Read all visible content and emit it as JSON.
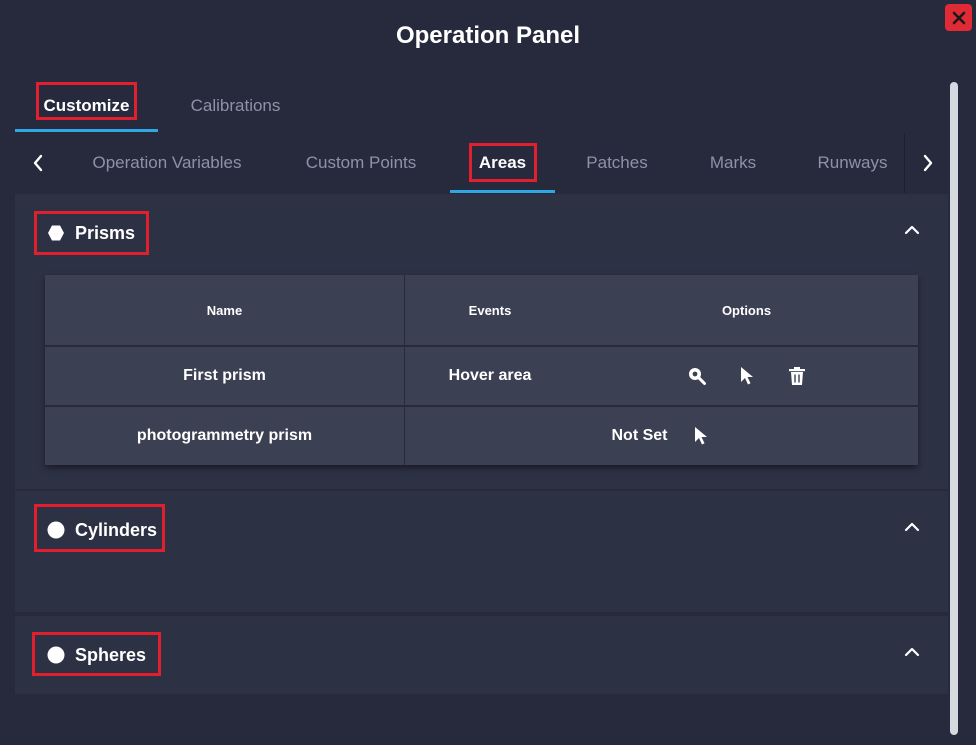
{
  "panel": {
    "title": "Operation Panel"
  },
  "main_tabs": [
    {
      "label": "Customize",
      "active": true
    },
    {
      "label": "Calibrations",
      "active": false
    }
  ],
  "sub_tabs": [
    {
      "label": "Operation Variables",
      "active": false
    },
    {
      "label": "Custom Points",
      "active": false
    },
    {
      "label": "Areas",
      "active": true
    },
    {
      "label": "Patches",
      "active": false
    },
    {
      "label": "Marks",
      "active": false
    },
    {
      "label": "Runways",
      "active": false
    }
  ],
  "sections": {
    "prisms": {
      "title": "Prisms",
      "icon": "hexagon-icon",
      "table": {
        "headers": {
          "name": "Name",
          "events": "Events",
          "options": "Options"
        },
        "rows": [
          {
            "name": "First prism",
            "events": "Hover area",
            "options": [
              "zoom-search-icon",
              "pointer-icon",
              "trash-icon"
            ]
          },
          {
            "name": "photogrammetry prism",
            "events_options": "Not Set",
            "options": [
              "pointer-icon"
            ]
          }
        ]
      }
    },
    "cylinders": {
      "title": "Cylinders",
      "icon": "circle-icon"
    },
    "spheres": {
      "title": "Spheres",
      "icon": "circle-icon"
    }
  },
  "colors": {
    "background": "#262a3c",
    "section": "#2d3144",
    "table": "#3c4053",
    "accent": "#2fa7e3",
    "highlight": "#e0202e",
    "close": "#e02a35",
    "inactive_text": "#8d92a6"
  }
}
